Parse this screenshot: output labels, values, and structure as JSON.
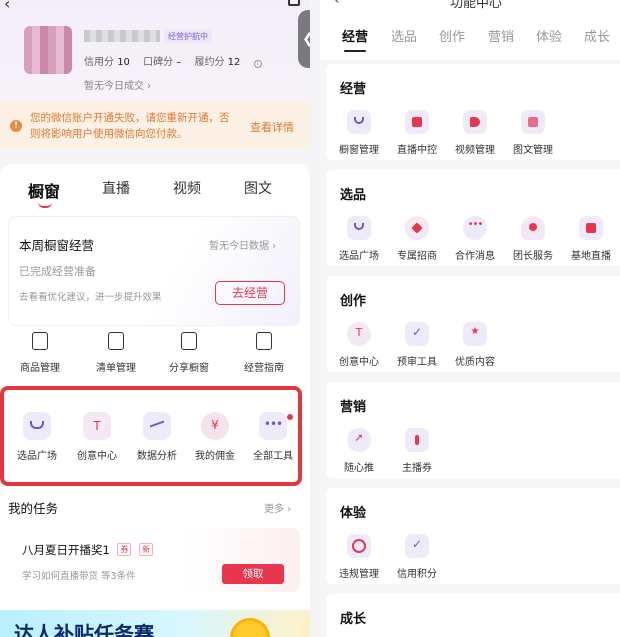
{
  "profile": {
    "guard_badge": "经营护航中",
    "credit_label": "信用分",
    "credit_value": "10",
    "reputation_label": "口碑分",
    "reputation_value": "–",
    "fulfill_label": "履约分",
    "fulfill_value": "12",
    "no_deal_today": "暂无今日成交"
  },
  "warning": {
    "text": "您的微信账户开通失败，请您重新开通，否则将影响用户使用微信向您付款。",
    "link": "查看详情"
  },
  "left_tabs": [
    "橱窗",
    "直播",
    "视频",
    "图文"
  ],
  "weekly": {
    "title": "本周橱窗经营",
    "no_data": "暂无今日数据",
    "status": "已完成经营准备",
    "tip": "去看看优化建议，进一步提升效果",
    "button": "去经营"
  },
  "quick_links": [
    "商品管理",
    "清单管理",
    "分享橱窗",
    "经营指南"
  ],
  "tools": [
    "选品广场",
    "创意中心",
    "数据分析",
    "我的佣金",
    "全部工具"
  ],
  "tasks": {
    "title": "我的任务",
    "more": "更多",
    "card_title": "八月夏日开播奖1",
    "tag1": "券",
    "tag2": "新",
    "card_sub": "学习如何直播带货  等3条件",
    "claim": "领取"
  },
  "banner": {
    "text": "达人补贴任务赛"
  },
  "right": {
    "title": "功能中心",
    "tabs": [
      "经营",
      "选品",
      "创作",
      "营销",
      "体验",
      "成长"
    ],
    "sections": [
      {
        "title": "经营",
        "items": [
          "橱窗管理",
          "直播中控",
          "视频管理",
          "图文管理"
        ]
      },
      {
        "title": "选品",
        "items": [
          "选品广场",
          "专属招商",
          "合作消息",
          "团长服务",
          "基地直播"
        ]
      },
      {
        "title": "创作",
        "items": [
          "创意中心",
          "预审工具",
          "优质内容"
        ]
      },
      {
        "title": "营销",
        "items": [
          "随心推",
          "主播券"
        ]
      },
      {
        "title": "体验",
        "items": [
          "违规管理",
          "信用积分"
        ]
      },
      {
        "title": "成长",
        "items": []
      }
    ]
  },
  "colors": {
    "accent": "#e8364e",
    "highlight_border": "#e0383c",
    "warning": "#e07a30",
    "icon_purple": "#7a62e0"
  }
}
